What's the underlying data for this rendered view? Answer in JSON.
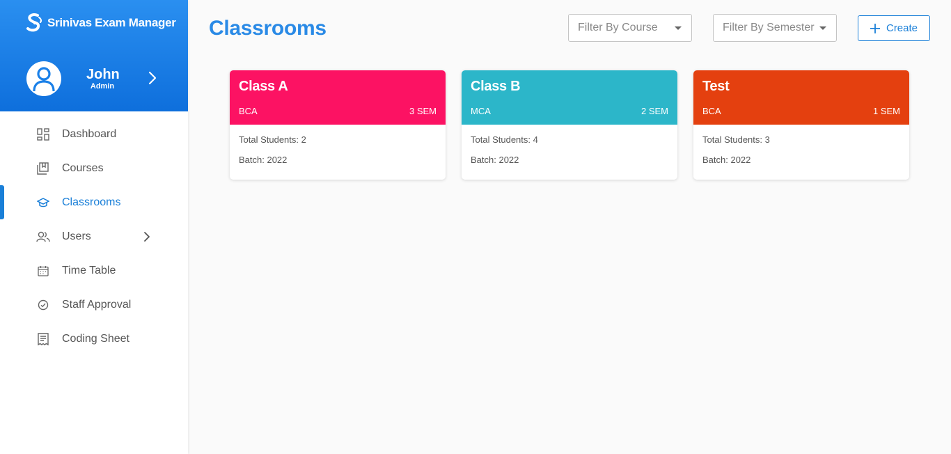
{
  "app": {
    "name": "Srinivas Exam Manager"
  },
  "user": {
    "name": "John",
    "role": "Admin"
  },
  "nav": [
    {
      "label": "Dashboard",
      "icon": "dashboard-icon",
      "active": false
    },
    {
      "label": "Courses",
      "icon": "courses-icon",
      "active": false
    },
    {
      "label": "Classrooms",
      "icon": "graduation-cap-icon",
      "active": true
    },
    {
      "label": "Users",
      "icon": "users-icon",
      "active": false,
      "has_submenu": true
    },
    {
      "label": "Time Table",
      "icon": "calendar-icon",
      "active": false
    },
    {
      "label": "Staff Approval",
      "icon": "check-circle-icon",
      "active": false
    },
    {
      "label": "Coding Sheet",
      "icon": "receipt-icon",
      "active": false
    }
  ],
  "page": {
    "title": "Classrooms"
  },
  "filters": {
    "course_placeholder": "Filter By Course",
    "semester_placeholder": "Filter By Semester"
  },
  "toolbar": {
    "create_label": "Create"
  },
  "classrooms": [
    {
      "name": "Class A",
      "course": "BCA",
      "semester": "3 SEM",
      "total_students": "Total Students: 2",
      "batch": "Batch: 2022",
      "color": "#fc1263"
    },
    {
      "name": "Class B",
      "course": "MCA",
      "semester": "2 SEM",
      "total_students": "Total Students: 4",
      "batch": "Batch: 2022",
      "color": "#2cb6c9"
    },
    {
      "name": "Test",
      "course": "BCA",
      "semester": "1 SEM",
      "total_students": "Total Students: 3",
      "batch": "Batch: 2022",
      "color": "#e4400f"
    }
  ],
  "colors": {
    "accent": "#1a7fd8",
    "header_gradient_top": "#2a8ff0",
    "header_gradient_bottom": "#0e6fdc"
  }
}
